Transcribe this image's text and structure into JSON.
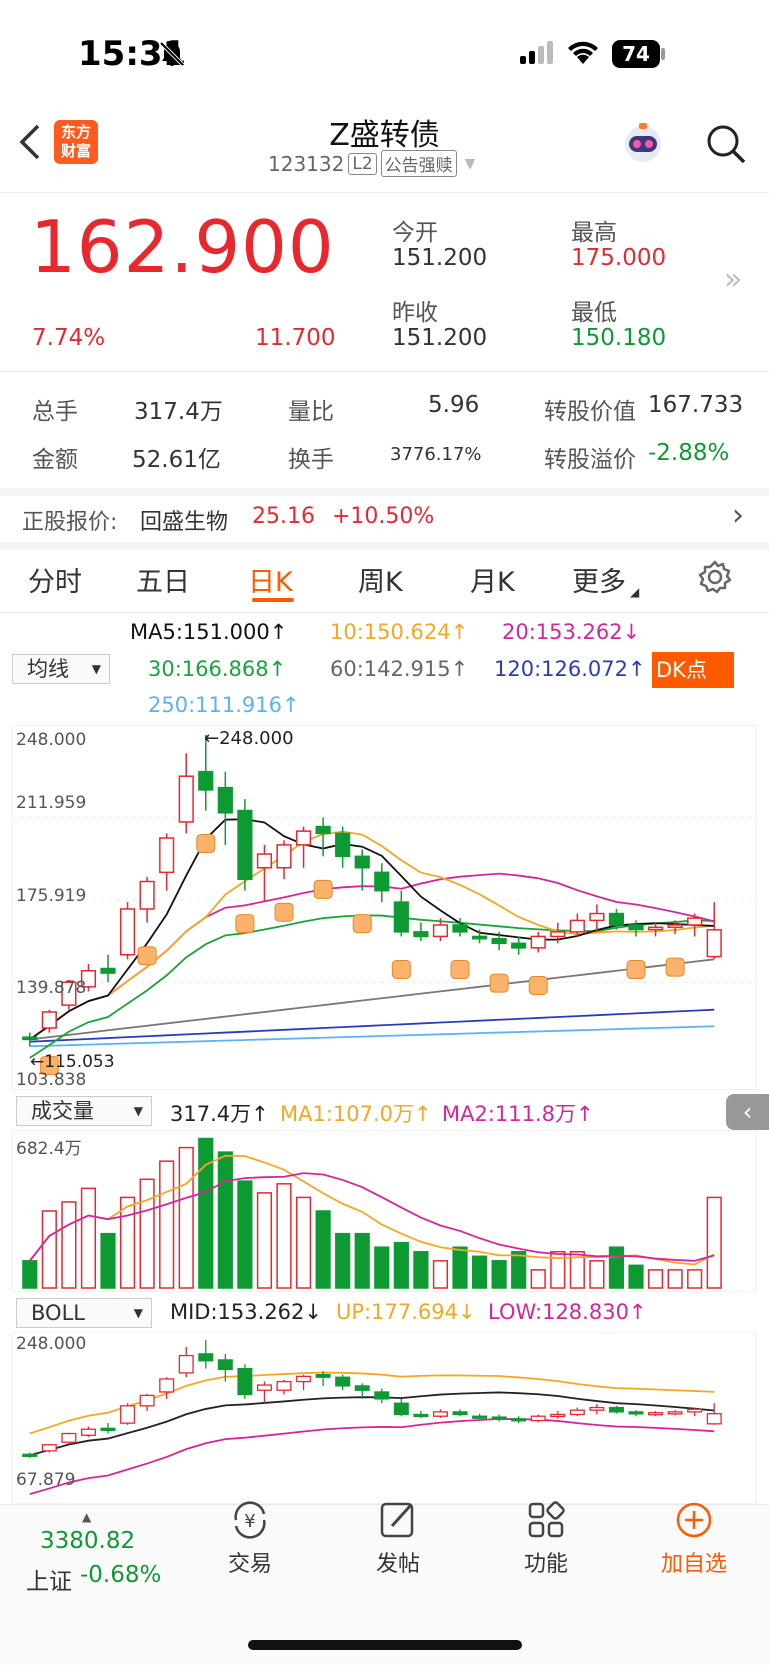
{
  "status_bar": {
    "time": "15:31",
    "battery": "74"
  },
  "header": {
    "app_logo_line1": "东方",
    "app_logo_line2": "财富",
    "title": "Z盛转债",
    "code": "123132",
    "level_badge": "L2",
    "notice_badge": "公告强赎"
  },
  "quote": {
    "price": "162.900",
    "change_pct": "7.74%",
    "change_amt": "11.700",
    "open_label": "今开",
    "open": "151.200",
    "high_label": "最高",
    "high": "175.000",
    "prev_close_label": "昨收",
    "prev_close": "151.200",
    "low_label": "最低",
    "low": "150.180"
  },
  "stats": {
    "volume_label": "总手",
    "volume": "317.4万",
    "vol_ratio_label": "量比",
    "vol_ratio": "5.96",
    "conv_value_label": "转股价值",
    "conv_value": "167.733",
    "amount_label": "金额",
    "amount": "52.61亿",
    "turnover_label": "换手",
    "turnover": "3776.17%",
    "premium_label": "转股溢价",
    "premium": "-2.88%"
  },
  "underlying": {
    "label": "正股报价:",
    "name": "回盛生物",
    "price": "25.16",
    "change": "+10.50%"
  },
  "tabs": [
    "分时",
    "五日",
    "日K",
    "周K",
    "月K",
    "更多"
  ],
  "active_tab": "日K",
  "ma_legend": {
    "selector": "均线",
    "ma5": "MA5:151.000↑",
    "ma10": "10:150.624↑",
    "ma20": "20:153.262↓",
    "ma30": "30:166.868↑",
    "ma60": "60:142.915↑",
    "ma120": "120:126.072↑",
    "ma250": "250:111.916↑",
    "dk_button": "DK点"
  },
  "price_axis": {
    "top": "248.000",
    "l2": "211.959",
    "l3": "175.919",
    "l4": "139.878",
    "bottom": "103.838",
    "max_marker": "←248.000",
    "min_marker": "←115.053"
  },
  "volume_legend": {
    "selector": "成交量",
    "vol": "317.4万↑",
    "ma1": "MA1:107.0万↑",
    "ma2": "MA2:111.8万↑",
    "max": "682.4万"
  },
  "boll_legend": {
    "selector": "BOLL",
    "mid": "MID:153.262↓",
    "up": "UP:177.694↓",
    "low": "LOW:128.830↑",
    "top": "248.000",
    "bottom": "67.879"
  },
  "chart_data": {
    "type": "candlestick",
    "series": [
      {
        "name": "K线",
        "ohlc": [
          [
            116,
            118,
            112,
            115
          ],
          [
            120,
            128,
            118,
            127
          ],
          [
            130,
            141,
            128,
            140
          ],
          [
            138,
            148,
            136,
            145
          ],
          [
            146,
            152,
            140,
            144
          ],
          [
            152,
            175,
            150,
            172
          ],
          [
            172,
            186,
            166,
            184
          ],
          [
            188,
            205,
            180,
            203
          ],
          [
            210,
            240,
            205,
            230
          ],
          [
            232,
            248,
            215,
            224
          ],
          [
            225,
            232,
            200,
            214
          ],
          [
            215,
            220,
            180,
            185
          ],
          [
            190,
            200,
            175,
            196
          ],
          [
            190,
            202,
            185,
            200
          ],
          [
            200,
            208,
            190,
            206
          ],
          [
            208,
            212,
            195,
            205
          ],
          [
            205,
            208,
            190,
            195
          ],
          [
            195,
            198,
            180,
            190
          ],
          [
            188,
            192,
            175,
            180
          ],
          [
            175,
            180,
            160,
            162
          ],
          [
            162,
            166,
            158,
            160
          ],
          [
            160,
            168,
            158,
            165
          ],
          [
            165,
            168,
            160,
            162
          ],
          [
            160,
            163,
            157,
            159
          ],
          [
            159,
            162,
            154,
            157
          ],
          [
            157,
            160,
            152,
            155
          ],
          [
            155,
            162,
            153,
            160
          ],
          [
            160,
            166,
            157,
            162
          ],
          [
            162,
            170,
            160,
            167
          ],
          [
            167,
            174,
            162,
            170
          ],
          [
            170,
            172,
            163,
            165
          ],
          [
            165,
            167,
            160,
            163
          ],
          [
            163,
            166,
            160,
            164
          ],
          [
            164,
            167,
            161,
            165
          ],
          [
            165,
            170,
            160,
            168
          ],
          [
            151.2,
            175,
            150.18,
            162.9
          ]
        ]
      }
    ],
    "ma": {
      "MA5": "151.000",
      "MA10": "150.624",
      "MA20": "153.262",
      "MA30": "166.868",
      "MA60": "142.915",
      "MA120": "126.072",
      "MA250": "111.916"
    },
    "volume": [
      30,
      85,
      95,
      110,
      60,
      100,
      120,
      140,
      155,
      165,
      150,
      118,
      105,
      115,
      100,
      85,
      60,
      60,
      45,
      50,
      40,
      30,
      45,
      35,
      30,
      40,
      20,
      40,
      40,
      30,
      45,
      25,
      20,
      20,
      20,
      100
    ],
    "boll": {
      "MID": "153.262",
      "UP": "177.694",
      "LOW": "128.830"
    },
    "ylim": [
      103.838,
      248.0
    ]
  },
  "bottom_bar": {
    "index_value": "3380.82",
    "index_name": "上证",
    "index_change": "-0.68%",
    "trade": "交易",
    "post": "发帖",
    "function": "功能",
    "add_watch": "加自选"
  },
  "colors": {
    "up": "#e8272f",
    "down": "#0e9a33",
    "accent": "#ff6a00",
    "ma5": "#111111",
    "ma10": "#f5a623",
    "ma20": "#d6249f",
    "ma30": "#18a43a",
    "ma60": "#777777",
    "ma120": "#2b3bbf",
    "ma250": "#5ab3f2"
  }
}
